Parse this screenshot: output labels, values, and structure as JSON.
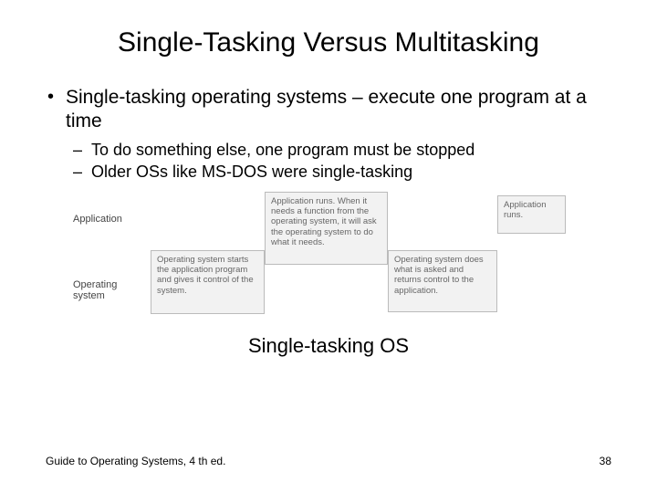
{
  "title": "Single-Tasking Versus Multitasking",
  "bullets": {
    "b1": "Single-tasking operating systems – execute one program at a time",
    "b2a": "To do something else, one program must be stopped",
    "b2b": "Older OSs like MS-DOS were single-tasking"
  },
  "diagram": {
    "labels": {
      "application": "Application",
      "os": "Operating system"
    },
    "boxes": {
      "os_start": "Operating system starts the application program and gives it control of the system.",
      "app_asks": "Application runs. When it needs a function from the operating system, it will ask the operating system to do what it needs.",
      "os_does": "Operating system does what is asked and returns control to the application.",
      "app_runs": "Application runs."
    }
  },
  "caption": "Single-tasking OS",
  "footer": "Guide to Operating Systems, 4 th ed.",
  "page": "38"
}
